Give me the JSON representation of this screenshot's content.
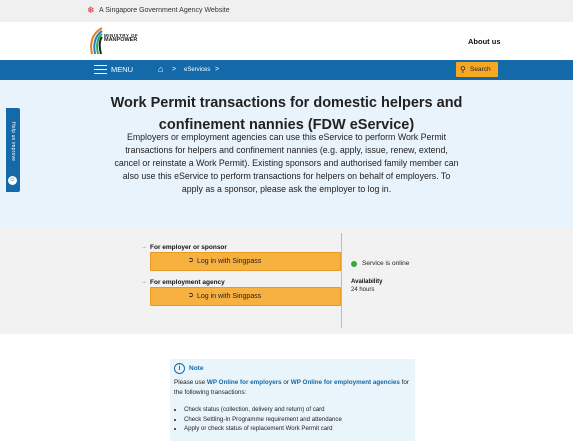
{
  "gov_banner": {
    "text": "A Singapore Government Agency Website",
    "lion_icon": "lion-head-icon"
  },
  "logo": {
    "line1": "MINISTRY OF",
    "line2": "MANPOWER"
  },
  "header": {
    "about": "About us"
  },
  "nav": {
    "menu": "MENU",
    "home_icon": "home-icon",
    "separator": ">",
    "breadcrumb": "eServices",
    "search": "Search"
  },
  "hero": {
    "title": "Work Permit transactions for domestic helpers and confinement nannies (FDW eService)",
    "description": "Employers or employment agencies can use this eService to perform Work Permit transactions for helpers and confinement nannies (e.g. apply, issue, renew, extend, cancel or reinstate a Work Permit). Existing sponsors and authorised family member can also use this eService to perform transactions for helpers on behalf of employers. To apply as a sponsor, please ask the employer to log in."
  },
  "feedback": {
    "label": "Help us improve"
  },
  "login": {
    "employer_label": "For employer or sponsor",
    "agency_label": "For employment agency",
    "singpass_label": "Log in with Singpass",
    "status": "Service is online",
    "availability_label": "Availability",
    "availability_value": "24 hours"
  },
  "colors": {
    "primary": "#1469a8",
    "accent": "#f7a823",
    "online": "#35a839"
  },
  "note": {
    "title": "Note",
    "text_before": "Please use ",
    "link1": "WP Online for employers",
    "text_mid": " or ",
    "link2": "WP Online for employment agencies",
    "text_after": " for the following transactions:",
    "items": [
      "Check status (collection, delivery and return) of card",
      "Check Settling-In Programme requirement and attendance",
      "Apply or check status of replacement Work Permit card"
    ]
  }
}
